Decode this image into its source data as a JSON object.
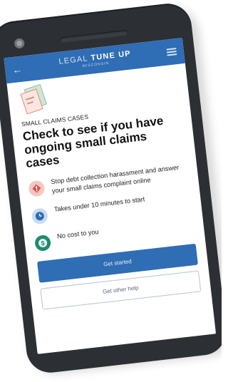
{
  "app": {
    "brand_main_light": "LEGAL ",
    "brand_main_bold": "TUNE UP",
    "brand_sub": "WISCONSIN",
    "back_icon": "arrow-left-icon",
    "menu_icon": "hamburger-menu-icon"
  },
  "page": {
    "eyebrow": "SMALL CLAIMS CASES",
    "title": "Check to see if you have ongoing small claims cases"
  },
  "features": [
    {
      "icon": "alert-icon",
      "text": "Stop debt collection harassment and answer your small claims complaint online"
    },
    {
      "icon": "clock-icon",
      "text": "Takes under 10 minutes to start"
    },
    {
      "icon": "dollar-icon",
      "text": "No cost to you"
    }
  ],
  "actions": {
    "primary": "Get started",
    "secondary": "Get other help"
  },
  "colors": {
    "primary": "#2f6db5",
    "alert_bg": "#f3c7c0",
    "clock_bg": "#c9dcf2",
    "dollar_bg": "#1f8a70"
  }
}
